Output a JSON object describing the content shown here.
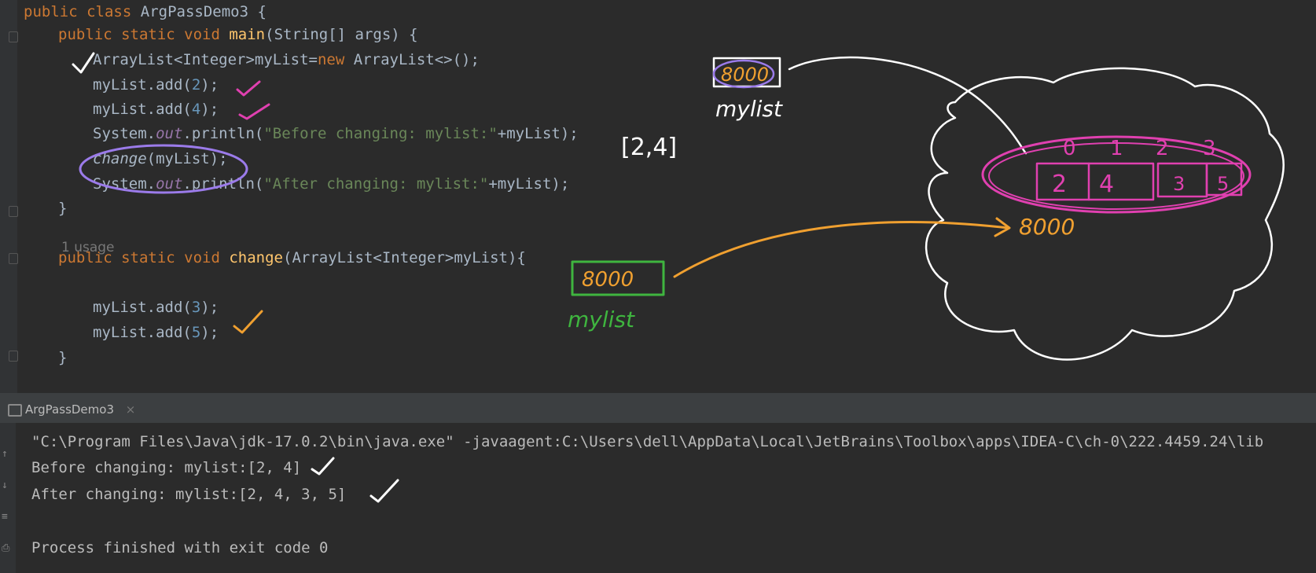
{
  "editor": {
    "lines": {
      "l1_public": "public",
      "l1_class": "class",
      "l1_name": "ArgPassDemo3 {",
      "l2_mods": "public static void",
      "l2_fn": "main",
      "l2_rest": "(String[] args) {",
      "l3_a": "ArrayList<Integer>myList=",
      "l3_new": "new",
      "l3_b": "ArrayList<>();",
      "l4_a": "myList.add(",
      "l4_num": "2",
      "l4_b": ");",
      "l5_a": "myList.add(",
      "l5_num": "4",
      "l5_b": ");",
      "l6_a": "System.",
      "l6_out": "out",
      "l6_b": ".println(",
      "l6_str": "\"Before changing: mylist:\"",
      "l6_c": "+myList);",
      "l7_call": "change",
      "l7_rest": "(myList);",
      "l8_a": "System.",
      "l8_out": "out",
      "l8_b": ".println(",
      "l8_str": "\"After changing: mylist:\"",
      "l8_c": "+myList);",
      "l9": "}",
      "usage": "1 usage",
      "l11_mods": "public static void",
      "l11_fn": "change",
      "l11_rest": "(ArrayList<Integer>myList){",
      "l13_a": "myList.add(",
      "l13_num": "3",
      "l13_b": ");",
      "l14_a": "myList.add(",
      "l14_num": "5",
      "l14_b": ");",
      "l15": "}"
    }
  },
  "run_panel": {
    "tab_label": "ArgPassDemo3",
    "tab_close": "×"
  },
  "console": {
    "command": "\"C:\\Program Files\\Java\\jdk-17.0.2\\bin\\java.exe\" -javaagent:C:\\Users\\dell\\AppData\\Local\\JetBrains\\Toolbox\\apps\\IDEA-C\\ch-0\\222.4459.24\\lib",
    "out1": "Before changing: mylist:[2, 4]",
    "out2": "After changing: mylist:[2, 4, 3, 5]",
    "finish": "Process finished with exit code 0"
  },
  "annotations": {
    "list_print": "[2,4]",
    "addr_top": "8000",
    "label_top": "mylist",
    "addr_mid": "8000",
    "label_mid": "mylist",
    "addr_heap": "8000",
    "idx0": "0",
    "idx1": "1",
    "idx2": "2",
    "idx3": "3",
    "cell0": "2",
    "cell1": "4",
    "cell2": "3",
    "cell3": "5"
  },
  "colors": {
    "ink_white": "#ffffff",
    "ink_pink": "#e040b0",
    "ink_purple": "#9b7bea",
    "ink_green": "#3fb53f",
    "ink_orange": "#f0a030"
  }
}
